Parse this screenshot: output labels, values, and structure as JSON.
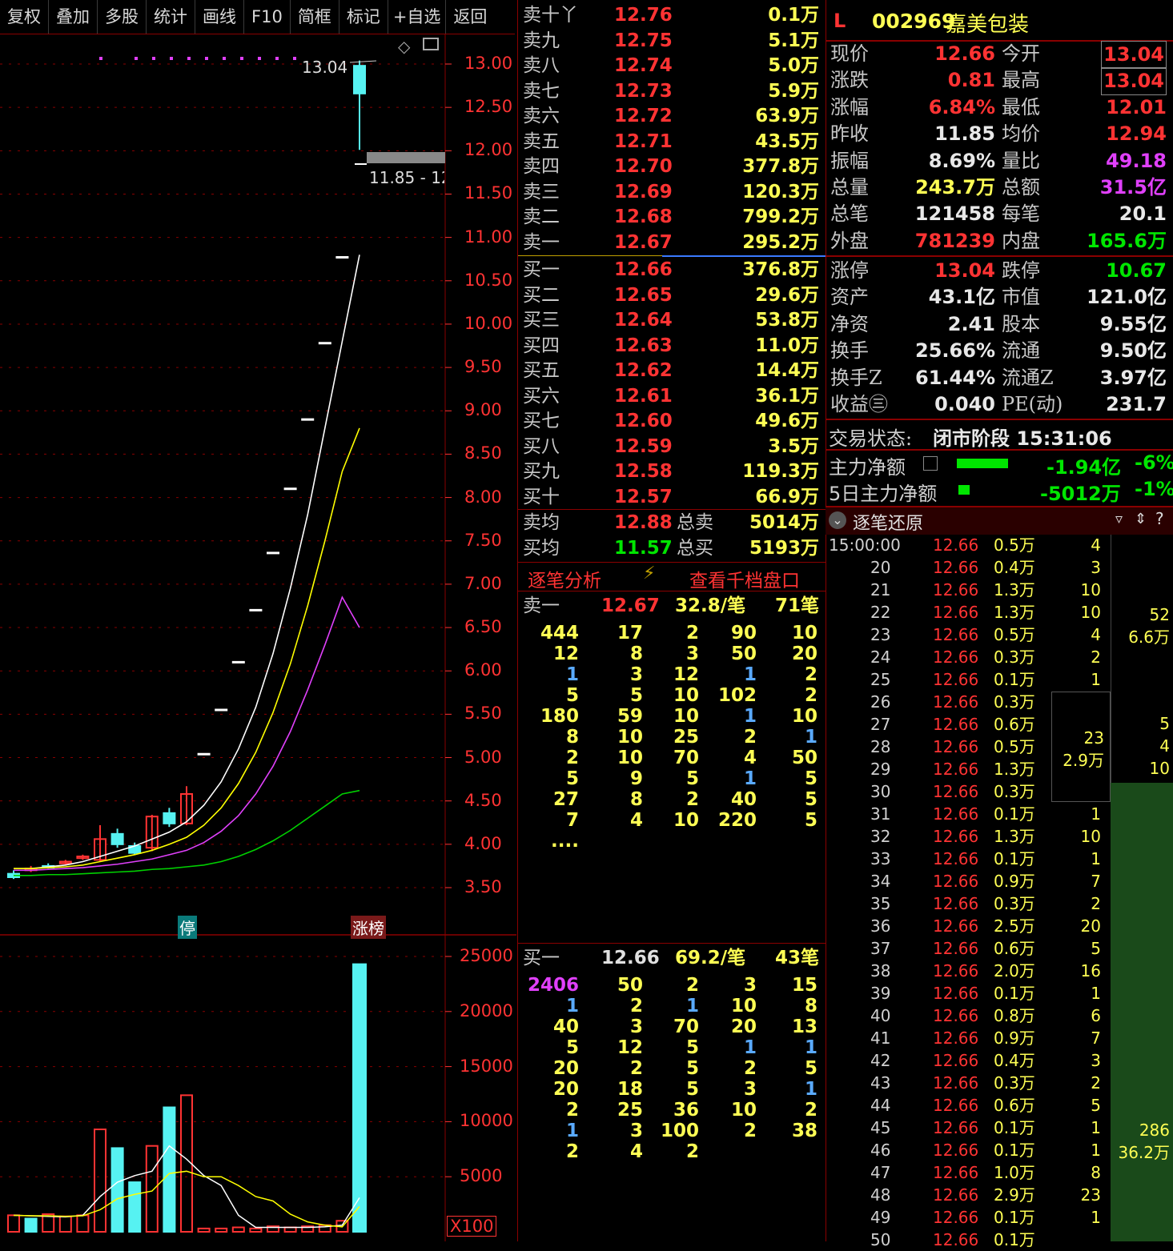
{
  "toolbar": {
    "items": [
      "复权",
      "叠加",
      "多股",
      "统计",
      "画线",
      "F10",
      "简框",
      "标记",
      "+自选",
      "返回"
    ]
  },
  "chart": {
    "price_axis": [
      "13.00",
      "12.50",
      "12.00",
      "11.50",
      "11.00",
      "10.50",
      "10.00",
      "9.50",
      "9.00",
      "8.50",
      "8.00",
      "7.50",
      "7.00",
      "6.50",
      "6.00",
      "5.50",
      "5.00",
      "4.50",
      "4.00",
      "3.50"
    ],
    "high_label": "13.04",
    "low_label": "11.85 - 12",
    "marker_stop": "停",
    "marker_limit": "涨榜",
    "vol_axis": [
      "25000",
      "20000",
      "15000",
      "10000",
      "5000"
    ],
    "vol_unit": "X100"
  },
  "chart_data": {
    "type": "candlestick",
    "ylim": [
      3.3,
      13.3
    ],
    "candles": [
      {
        "o": 3.66,
        "c": 3.62,
        "h": 3.7,
        "l": 3.6,
        "up": false
      },
      {
        "o": 3.7,
        "c": 3.72,
        "h": 3.75,
        "l": 3.68,
        "up": true
      },
      {
        "o": 3.75,
        "c": 3.74,
        "h": 3.78,
        "l": 3.72,
        "up": false
      },
      {
        "o": 3.78,
        "c": 3.8,
        "h": 3.82,
        "l": 3.76,
        "up": true
      },
      {
        "o": 3.84,
        "c": 3.86,
        "h": 3.88,
        "l": 3.82,
        "up": true
      },
      {
        "o": 3.82,
        "c": 4.06,
        "h": 4.22,
        "l": 3.8,
        "up": true
      },
      {
        "o": 4.12,
        "c": 4.0,
        "h": 4.18,
        "l": 3.96,
        "up": false
      },
      {
        "o": 3.98,
        "c": 3.9,
        "h": 4.02,
        "l": 3.88,
        "up": false
      },
      {
        "o": 3.96,
        "c": 4.32,
        "h": 4.34,
        "l": 3.92,
        "up": true
      },
      {
        "o": 4.36,
        "c": 4.24,
        "h": 4.42,
        "l": 4.2,
        "up": false
      },
      {
        "o": 4.24,
        "c": 4.58,
        "h": 4.67,
        "l": 4.22,
        "up": true
      },
      {
        "o": 5.04,
        "c": 5.04,
        "h": 5.04,
        "l": 5.04,
        "up": true
      },
      {
        "o": 5.55,
        "c": 5.55,
        "h": 5.55,
        "l": 5.55,
        "up": true
      },
      {
        "o": 6.1,
        "c": 6.1,
        "h": 6.1,
        "l": 6.1,
        "up": true
      },
      {
        "o": 6.7,
        "c": 6.7,
        "h": 6.7,
        "l": 6.7,
        "up": true
      },
      {
        "o": 7.36,
        "c": 7.36,
        "h": 7.36,
        "l": 7.36,
        "up": true
      },
      {
        "o": 8.1,
        "c": 8.1,
        "h": 8.1,
        "l": 8.1,
        "up": true
      },
      {
        "o": 8.9,
        "c": 8.9,
        "h": 8.9,
        "l": 8.9,
        "up": true
      },
      {
        "o": 9.78,
        "c": 9.78,
        "h": 9.78,
        "l": 9.78,
        "up": true
      },
      {
        "o": 10.77,
        "c": 10.77,
        "h": 10.77,
        "l": 10.77,
        "up": true
      },
      {
        "o": 12.98,
        "c": 12.66,
        "h": 13.04,
        "l": 12.01,
        "up": false
      }
    ],
    "ma_white": [
      3.72,
      3.72,
      3.74,
      3.76,
      3.8,
      3.86,
      3.92,
      3.98,
      4.06,
      4.14,
      4.26,
      4.45,
      4.72,
      5.1,
      5.58,
      6.2,
      6.95,
      7.8,
      8.8,
      9.8,
      10.8
    ],
    "ma_yellow": [
      3.72,
      3.72,
      3.73,
      3.74,
      3.76,
      3.8,
      3.84,
      3.88,
      3.93,
      4.0,
      4.08,
      4.22,
      4.42,
      4.7,
      5.06,
      5.52,
      6.08,
      6.75,
      7.5,
      8.3,
      8.8
    ],
    "ma_magenta": [
      3.7,
      3.7,
      3.71,
      3.72,
      3.73,
      3.75,
      3.77,
      3.8,
      3.83,
      3.88,
      3.93,
      4.02,
      4.15,
      4.33,
      4.58,
      4.9,
      5.3,
      5.78,
      6.3,
      6.85,
      6.5
    ],
    "ma_green": [
      3.64,
      3.64,
      3.65,
      3.65,
      3.66,
      3.67,
      3.68,
      3.69,
      3.71,
      3.72,
      3.74,
      3.76,
      3.8,
      3.86,
      3.94,
      4.04,
      4.16,
      4.3,
      4.44,
      4.58,
      4.62
    ],
    "volumes": [
      1500,
      1200,
      1600,
      1400,
      1500,
      9300,
      7600,
      4500,
      7800,
      11300,
      12400,
      300,
      300,
      400,
      300,
      500,
      400,
      500,
      600,
      1000,
      24300
    ],
    "vol_ylim": [
      0,
      27000
    ]
  },
  "book": {
    "asks": [
      {
        "label": "卖十丫",
        "price": "12.76",
        "vol": "0.1万"
      },
      {
        "label": "卖九",
        "price": "12.75",
        "vol": "5.1万"
      },
      {
        "label": "卖八",
        "price": "12.74",
        "vol": "5.0万"
      },
      {
        "label": "卖七",
        "price": "12.73",
        "vol": "5.9万"
      },
      {
        "label": "卖六",
        "price": "12.72",
        "vol": "63.9万"
      },
      {
        "label": "卖五",
        "price": "12.71",
        "vol": "43.5万"
      },
      {
        "label": "卖四",
        "price": "12.70",
        "vol": "377.8万"
      },
      {
        "label": "卖三",
        "price": "12.69",
        "vol": "120.3万"
      },
      {
        "label": "卖二",
        "price": "12.68",
        "vol": "799.2万"
      },
      {
        "label": "卖一",
        "price": "12.67",
        "vol": "295.2万"
      }
    ],
    "bids": [
      {
        "label": "买一",
        "price": "12.66",
        "vol": "376.8万"
      },
      {
        "label": "买二",
        "price": "12.65",
        "vol": "29.6万"
      },
      {
        "label": "买三",
        "price": "12.64",
        "vol": "53.8万"
      },
      {
        "label": "买四",
        "price": "12.63",
        "vol": "11.0万"
      },
      {
        "label": "买五",
        "price": "12.62",
        "vol": "14.4万"
      },
      {
        "label": "买六",
        "price": "12.61",
        "vol": "36.1万"
      },
      {
        "label": "买七",
        "price": "12.60",
        "vol": "49.6万"
      },
      {
        "label": "买八",
        "price": "12.59",
        "vol": "3.5万"
      },
      {
        "label": "买九",
        "price": "12.58",
        "vol": "119.3万"
      },
      {
        "label": "买十",
        "price": "12.57",
        "vol": "66.9万"
      }
    ],
    "avg_sell_label": "卖均",
    "avg_sell": "12.88",
    "total_sell_label": "总卖",
    "total_sell": "5014万",
    "avg_buy_label": "买均",
    "avg_buy": "11.57",
    "total_buy_label": "总买",
    "total_buy": "5193万",
    "tab_analysis": "逐笔分析",
    "tab_deep": "查看千档盘口",
    "ask1_label": "卖一",
    "ask1_price": "12.67",
    "ask1_avg": "32.8/笔",
    "ask1_count": "71笔",
    "ask1_grid": [
      [
        "444",
        "17",
        "2",
        "90",
        "10"
      ],
      [
        "12",
        "8",
        "3",
        "50",
        "20"
      ],
      [
        "1",
        "3",
        "12",
        "1",
        "2"
      ],
      [
        "5",
        "5",
        "10",
        "102",
        "2"
      ],
      [
        "180",
        "59",
        "10",
        "1",
        "10"
      ],
      [
        "8",
        "10",
        "25",
        "2",
        "1"
      ],
      [
        "2",
        "10",
        "70",
        "4",
        "50"
      ],
      [
        "5",
        "9",
        "5",
        "1",
        "5"
      ],
      [
        "27",
        "8",
        "2",
        "40",
        "5"
      ],
      [
        "7",
        "4",
        "10",
        "220",
        "5"
      ],
      [
        "....",
        "",
        "",
        "",
        ""
      ]
    ],
    "bid1_label": "买一",
    "bid1_price": "12.66",
    "bid1_avg": "69.2/笔",
    "bid1_count": "43笔",
    "bid1_grid": [
      [
        "2406",
        "50",
        "2",
        "3",
        "15"
      ],
      [
        "1",
        "2",
        "1",
        "10",
        "8"
      ],
      [
        "40",
        "3",
        "70",
        "20",
        "13"
      ],
      [
        "5",
        "12",
        "5",
        "1",
        "1"
      ],
      [
        "20",
        "2",
        "5",
        "2",
        "5"
      ],
      [
        "20",
        "18",
        "5",
        "3",
        "1"
      ],
      [
        "2",
        "25",
        "36",
        "10",
        "2"
      ],
      [
        "1",
        "3",
        "100",
        "2",
        "38"
      ],
      [
        "2",
        "4",
        "2",
        "",
        ""
      ]
    ]
  },
  "info": {
    "mark": "L",
    "code": "002969",
    "name": "嘉美包装",
    "rows1": [
      [
        "现价",
        "12.66",
        "今开",
        "13.04"
      ],
      [
        "涨跌",
        "0.81",
        "最高",
        "13.04"
      ],
      [
        "涨幅",
        "6.84%",
        "最低",
        "12.01"
      ],
      [
        "昨收",
        "11.85",
        "均价",
        "12.94"
      ],
      [
        "振幅",
        "8.69%",
        "量比",
        "49.18"
      ],
      [
        "总量",
        "243.7万",
        "总额",
        "31.5亿"
      ],
      [
        "总笔",
        "121458",
        "每笔",
        "20.1"
      ],
      [
        "外盘",
        "781239",
        "内盘",
        "165.6万"
      ]
    ],
    "rows2": [
      [
        "涨停",
        "13.04",
        "跌停",
        "10.67"
      ],
      [
        "资产",
        "43.1亿",
        "市值",
        "121.0亿"
      ],
      [
        "净资",
        "2.41",
        "股本",
        "9.55亿"
      ],
      [
        "换手",
        "25.66%",
        "流通",
        "9.50亿"
      ],
      [
        "换手Z",
        "61.44%",
        "流通Z",
        "3.97亿"
      ],
      [
        "收益㊂",
        "0.040",
        "PE(动)",
        "231.7"
      ]
    ],
    "status_label": "交易状态:",
    "status_value": "闭市阶段 15:31:06",
    "main_flow_label": "主力净额",
    "main_flow": "-1.94亿",
    "main_flow_pct": "-6%",
    "flow5_label": "5日主力净额",
    "flow5": "-5012万",
    "flow5_pct": "-1%",
    "ticks_title": "逐笔还原",
    "ticks": [
      [
        "15:00:00",
        "12.66",
        "0.5万",
        "4"
      ],
      [
        "20",
        "12.66",
        "0.4万",
        "3"
      ],
      [
        "21",
        "12.66",
        "1.3万",
        "10"
      ],
      [
        "22",
        "12.66",
        "1.3万",
        "10"
      ],
      [
        "23",
        "12.66",
        "0.5万",
        "4"
      ],
      [
        "24",
        "12.66",
        "0.3万",
        "2"
      ],
      [
        "25",
        "12.66",
        "0.1万",
        "1"
      ],
      [
        "26",
        "12.66",
        "0.3万",
        ""
      ],
      [
        "27",
        "12.66",
        "0.6万",
        ""
      ],
      [
        "28",
        "12.66",
        "0.5万",
        ""
      ],
      [
        "29",
        "12.66",
        "1.3万",
        ""
      ],
      [
        "30",
        "12.66",
        "0.3万",
        ""
      ],
      [
        "31",
        "12.66",
        "0.1万",
        "1"
      ],
      [
        "32",
        "12.66",
        "1.3万",
        "10"
      ],
      [
        "33",
        "12.66",
        "0.1万",
        "1"
      ],
      [
        "34",
        "12.66",
        "0.9万",
        "7"
      ],
      [
        "35",
        "12.66",
        "0.3万",
        "2"
      ],
      [
        "36",
        "12.66",
        "2.5万",
        "20"
      ],
      [
        "37",
        "12.66",
        "0.6万",
        "5"
      ],
      [
        "38",
        "12.66",
        "2.0万",
        "16"
      ],
      [
        "39",
        "12.66",
        "0.1万",
        "1"
      ],
      [
        "40",
        "12.66",
        "0.8万",
        "6"
      ],
      [
        "41",
        "12.66",
        "0.9万",
        "7"
      ],
      [
        "42",
        "12.66",
        "0.4万",
        "3"
      ],
      [
        "43",
        "12.66",
        "0.3万",
        "2"
      ],
      [
        "44",
        "12.66",
        "0.6万",
        "5"
      ],
      [
        "45",
        "12.66",
        "0.1万",
        "1"
      ],
      [
        "46",
        "12.66",
        "0.1万",
        "1"
      ],
      [
        "47",
        "12.66",
        "1.0万",
        "8"
      ],
      [
        "48",
        "12.66",
        "2.9万",
        "23"
      ],
      [
        "49",
        "12.66",
        "0.1万",
        "1"
      ],
      [
        "50",
        "12.66",
        "0.1万",
        ""
      ]
    ],
    "agg1_count": "52",
    "agg1_vol": "6.6万",
    "agg2_count": "23",
    "agg2_vol": "2.9万",
    "agg3": [
      "5",
      "4",
      "10"
    ],
    "agg4_count": "286",
    "agg4_vol": "36.2万"
  }
}
